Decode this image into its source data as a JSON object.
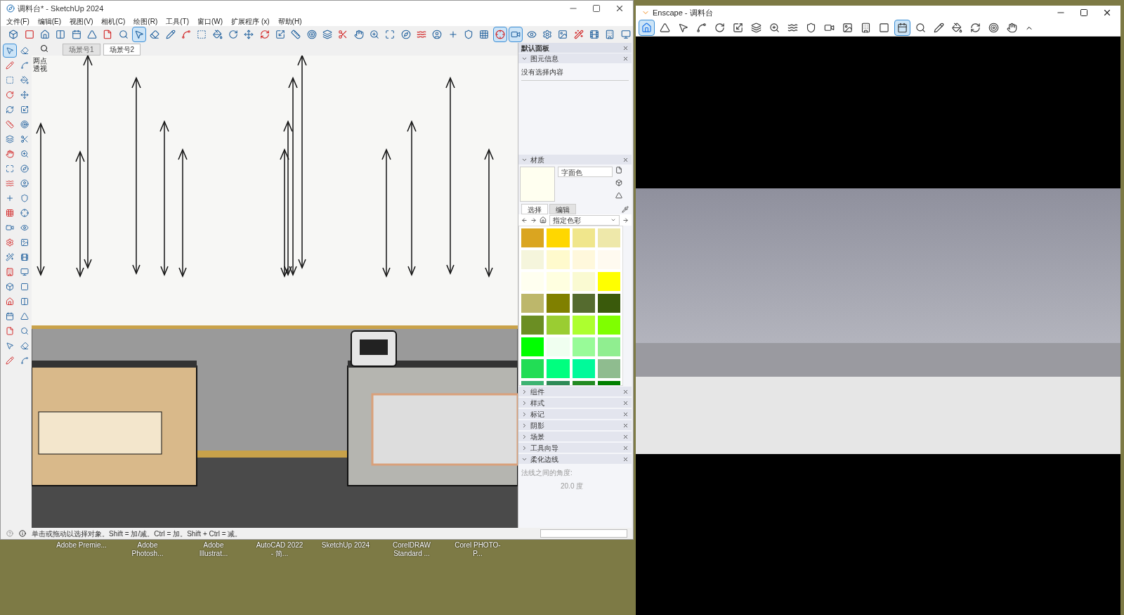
{
  "sketchup": {
    "title": "调料台* - SketchUp 2024",
    "menu": [
      "文件(F)",
      "编辑(E)",
      "视图(V)",
      "相机(C)",
      "绘图(R)",
      "工具(T)",
      "窗口(W)",
      "扩展程序 (x)",
      "帮助(H)"
    ],
    "toolbar": [
      {
        "selected": false
      },
      {
        "selected": false
      },
      {
        "selected": false
      },
      {
        "selected": false
      },
      {
        "selected": false
      },
      {
        "selected": false
      },
      {
        "selected": false
      },
      {
        "selected": false
      },
      {
        "selected": true
      },
      {
        "selected": false
      },
      {
        "selected": false
      },
      {
        "selected": false
      },
      {
        "selected": false
      },
      {
        "selected": false
      },
      {
        "selected": false
      },
      {
        "selected": false
      },
      {
        "selected": false
      },
      {
        "selected": false
      },
      {
        "selected": false
      },
      {
        "selected": false
      },
      {
        "selected": false
      },
      {
        "selected": false
      },
      {
        "selected": false
      },
      {
        "selected": false
      },
      {
        "selected": false
      },
      {
        "selected": false
      },
      {
        "selected": false
      },
      {
        "selected": false
      },
      {
        "selected": false
      },
      {
        "selected": false
      },
      {
        "selected": false
      },
      {
        "selected": true
      },
      {
        "selected": true
      },
      {
        "selected": false
      },
      {
        "selected": false
      },
      {
        "selected": false
      },
      {
        "selected": false
      },
      {
        "selected": false
      },
      {
        "selected": false
      },
      {
        "selected": false
      }
    ],
    "left_toolbar": [
      {
        "selected": true
      },
      {
        "selected": false
      },
      {
        "selected": false
      },
      {
        "selected": false
      },
      {
        "selected": false
      },
      {
        "selected": false
      },
      {
        "selected": false
      },
      {
        "selected": false
      },
      {
        "selected": false
      },
      {
        "selected": false
      },
      {
        "selected": false
      },
      {
        "selected": false
      },
      {
        "selected": false
      },
      {
        "selected": false
      },
      {
        "selected": false
      },
      {
        "selected": false
      },
      {
        "selected": false
      },
      {
        "selected": false
      },
      {
        "selected": false
      },
      {
        "selected": false
      },
      {
        "selected": false
      },
      {
        "selected": false
      },
      {
        "selected": false
      },
      {
        "selected": false
      },
      {
        "selected": false
      },
      {
        "selected": false
      },
      {
        "selected": false
      },
      {
        "selected": false
      },
      {
        "selected": false
      },
      {
        "selected": false
      },
      {
        "selected": false
      },
      {
        "selected": false
      },
      {
        "selected": false
      },
      {
        "selected": false
      },
      {
        "selected": false
      },
      {
        "selected": false
      },
      {
        "selected": false
      },
      {
        "selected": false
      },
      {
        "selected": false
      },
      {
        "selected": false
      },
      {
        "selected": false
      },
      {
        "selected": false
      },
      {
        "selected": false
      },
      {
        "selected": false
      }
    ],
    "scene_tabs": [
      {
        "label": "场景号1",
        "selected": false
      },
      {
        "label": "场景号2",
        "selected": true
      }
    ],
    "view_label": "两点透视",
    "panel": {
      "title": "默认面板",
      "entity_info": {
        "title": "图元信息",
        "expanded": true,
        "text": "没有选择内容"
      },
      "materials": {
        "title": "材质",
        "expanded": true,
        "name": "字面色",
        "tabs": [
          {
            "label": "选择",
            "selected": true
          },
          {
            "label": "编辑",
            "selected": false
          }
        ],
        "library": "指定色彩",
        "swatches": [
          {
            "color": "#daa520"
          },
          {
            "color": "#ffd700"
          },
          {
            "color": "#f0e68c"
          },
          {
            "color": "#eee8aa"
          },
          {
            "color": "#f5f5dc"
          },
          {
            "color": "#fffacd"
          },
          {
            "color": "#fff8dc"
          },
          {
            "color": "#fffaf0"
          },
          {
            "color": "#fffff0"
          },
          {
            "color": "#ffffe0"
          },
          {
            "color": "#fafad2"
          },
          {
            "color": "#ffff00"
          },
          {
            "color": "#bdb76b"
          },
          {
            "color": "#808000"
          },
          {
            "color": "#556b2f"
          },
          {
            "color": "#3a5a0c"
          },
          {
            "color": "#6b8e23"
          },
          {
            "color": "#9acd32"
          },
          {
            "color": "#adff2f"
          },
          {
            "color": "#7fff00"
          },
          {
            "color": "#00ff00"
          },
          {
            "color": "#f0fff0"
          },
          {
            "color": "#98fb98"
          },
          {
            "color": "#90ee90"
          },
          {
            "color": "#22dd55"
          },
          {
            "color": "#00ff7f"
          },
          {
            "color": "#00fa9a"
          },
          {
            "color": "#8fbc8f"
          },
          {
            "color": "#3cb371"
          },
          {
            "color": "#2e8b57"
          },
          {
            "color": "#228b22"
          },
          {
            "color": "#008000"
          }
        ]
      },
      "sections": [
        {
          "title": "组件",
          "expanded": false
        },
        {
          "title": "样式",
          "expanded": false
        },
        {
          "title": "标记",
          "expanded": false
        },
        {
          "title": "阴影",
          "expanded": false
        },
        {
          "title": "场景",
          "expanded": false
        },
        {
          "title": "工具向导",
          "expanded": false
        },
        {
          "title": "柔化边线",
          "expanded": true,
          "label": "法线之间的角度:",
          "value": "20.0 度"
        }
      ]
    },
    "status": "单击或拖动以选择对象。Shift = 加/减。Ctrl = 加。Shift + Ctrl = 减。"
  },
  "desktop_icons": [
    "Adobe Premie...",
    "Adobe Photosh...",
    "Adobe Illustrat...",
    "AutoCAD 2022 - 简...",
    "SketchUp 2024",
    "CorelDRAW Standard ...",
    "Corel PHOTO-P..."
  ],
  "enscape": {
    "title": "Enscape - 调料台",
    "toolbar": [
      {
        "selected": true
      },
      {
        "selected": false
      },
      {
        "selected": false
      },
      {
        "selected": false
      },
      {
        "selected": false
      },
      {
        "selected": false
      },
      {
        "selected": false
      },
      {
        "selected": false
      },
      {
        "selected": false
      },
      {
        "selected": false
      },
      {
        "selected": false
      },
      {
        "selected": false
      },
      {
        "selected": false
      },
      {
        "selected": false
      },
      {
        "selected": true
      },
      {
        "selected": false
      },
      {
        "selected": false
      },
      {
        "selected": false
      },
      {
        "selected": false
      },
      {
        "selected": false
      },
      {
        "selected": false
      }
    ]
  }
}
